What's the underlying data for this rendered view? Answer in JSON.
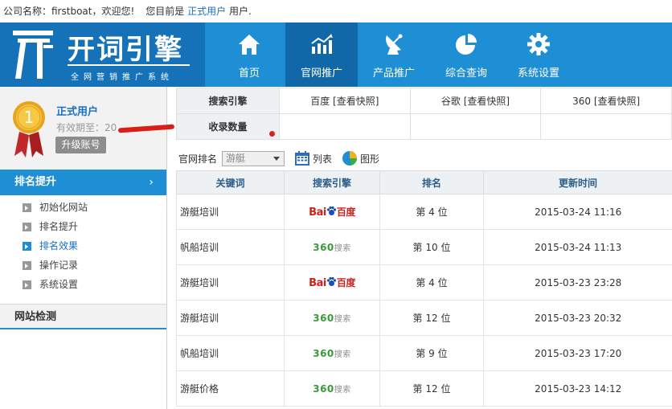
{
  "topbar": {
    "company_text": "公司名称：firstboat，欢迎您!",
    "status_prefix": "您目前是",
    "status_link": "正式用户",
    "status_suffix": "用户."
  },
  "header": {
    "logo_title": "开词引擎",
    "logo_subtitle": "全网营销推广系统",
    "nav": [
      {
        "label": "首页",
        "icon": "home-icon",
        "active": false
      },
      {
        "label": "官网推广",
        "icon": "chart-icon",
        "active": true
      },
      {
        "label": "产品推广",
        "icon": "satellite-dish-icon",
        "active": false
      },
      {
        "label": "综合查询",
        "icon": "pie-chart-icon",
        "active": false
      },
      {
        "label": "系统设置",
        "icon": "gear-icon",
        "active": false
      }
    ]
  },
  "profile": {
    "medal_number": "1",
    "user_type": "正式用户",
    "expire_label": "有效期至：20",
    "upgrade_label": "升级账号"
  },
  "sidebar": {
    "rank_section": "排名提升",
    "rank_chevron": "›",
    "items": [
      {
        "label": "初始化网站",
        "active": false
      },
      {
        "label": "排名提升",
        "active": false
      },
      {
        "label": "排名效果",
        "active": true
      },
      {
        "label": "操作记录",
        "active": false
      },
      {
        "label": "系统设置",
        "active": false
      }
    ],
    "site_section": "网站检测"
  },
  "engines": {
    "row1_header": "搜索引擎",
    "row2_header": "收录数量",
    "cells": [
      "百度 [查看快照]",
      "谷歌 [查看快照]",
      "360 [查看快照]"
    ]
  },
  "toolbar": {
    "label": "官网排名",
    "select_value": "游艇",
    "list_label": "列表",
    "graph_label": "图形"
  },
  "results": {
    "headers": [
      "关键词",
      "搜索引擎",
      "排名",
      "更新时间"
    ],
    "baidu_text1": "Bai",
    "baidu_text2": "百度",
    "s360_text": "360",
    "s360_small": "搜索",
    "rows": [
      {
        "keyword": "游艇培训",
        "engine": "baidu",
        "rank": "第 4 位",
        "time": "2015-03-24 11:16"
      },
      {
        "keyword": "帆船培训",
        "engine": "360",
        "rank": "第 10 位",
        "time": "2015-03-24 11:13"
      },
      {
        "keyword": "游艇培训",
        "engine": "baidu",
        "rank": "第 4 位",
        "time": "2015-03-23 23:28"
      },
      {
        "keyword": "游艇培训",
        "engine": "360",
        "rank": "第 12 位",
        "time": "2015-03-23 20:32"
      },
      {
        "keyword": "帆船培训",
        "engine": "360",
        "rank": "第 9 位",
        "time": "2015-03-23 17:20"
      },
      {
        "keyword": "游艇价格",
        "engine": "360",
        "rank": "第 12 位",
        "time": "2015-03-23 14:12"
      }
    ]
  },
  "colors": {
    "header_blue": "#1e8fd4",
    "logo_blue": "#1672b8",
    "active_nav": "#1068a8",
    "link_blue": "#1a6fc2",
    "baidu_red": "#d0221a",
    "s360_green": "#3a9a3a"
  }
}
